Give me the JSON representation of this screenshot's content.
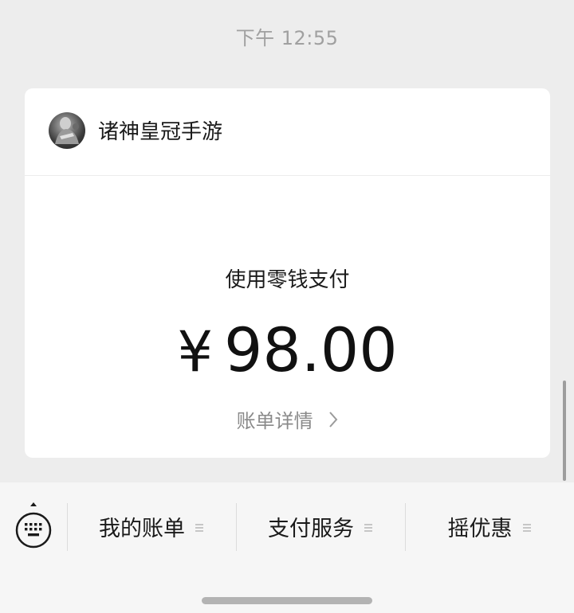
{
  "chat": {
    "timestamp": "下午 12:55"
  },
  "card": {
    "merchant_name": "诸神皇冠手游",
    "pay_method": "使用零钱支付",
    "currency_symbol": "¥",
    "amount": "98.00",
    "details_label": "账单详情"
  },
  "bottom_menu": {
    "items": [
      {
        "label": "我的账单"
      },
      {
        "label": "支付服务"
      },
      {
        "label": "摇优惠"
      }
    ]
  },
  "icons": {
    "keyboard_toggle": "keyboard-icon",
    "menu_indicator": "menu-lines-icon",
    "details_chevron": "chevron-right-icon",
    "merchant_avatar": "avatar"
  },
  "colors": {
    "background": "#ededed",
    "card": "#ffffff",
    "muted_text": "#8a8a8a",
    "bottom_bar": "#f6f6f6"
  }
}
